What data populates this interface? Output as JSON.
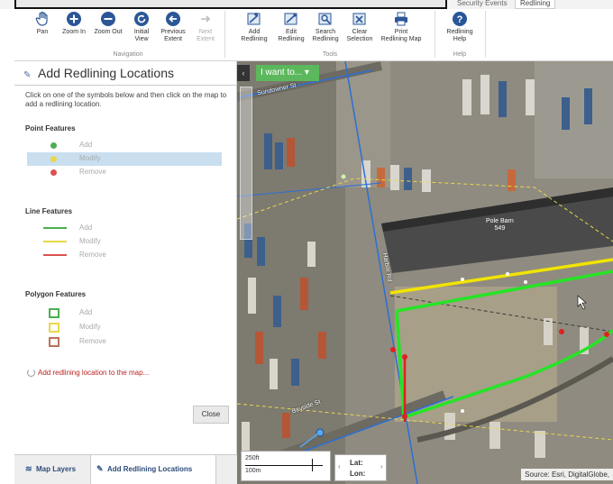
{
  "tabs": {
    "security": "Security Events",
    "redlining": "Redlining"
  },
  "ribbon": {
    "navigation": {
      "group_label": "Navigation",
      "pan": "Pan",
      "zoom_in": "Zoom In",
      "zoom_out": "Zoom Out",
      "initial_view_l1": "Initial",
      "initial_view_l2": "View",
      "previous_extent_l1": "Previous",
      "previous_extent_l2": "Extent",
      "next_extent_l1": "Next",
      "next_extent_l2": "Extent"
    },
    "tools": {
      "group_label": "Tools",
      "add_l1": "Add",
      "add_l2": "Redlining",
      "edit_l1": "Edit",
      "edit_l2": "Redlining",
      "search_l1": "Search",
      "search_l2": "Redlining",
      "clear_l1": "Clear",
      "clear_l2": "Selection",
      "print_l1": "Print",
      "print_l2": "Redlining Map"
    },
    "help": {
      "group_label": "Help",
      "help_l1": "Redlining",
      "help_l2": "Help"
    }
  },
  "panel": {
    "title": "Add Redlining Locations",
    "intro": "Click on one of the symbols below and then click on the map to add a redlining location.",
    "point": {
      "heading": "Point Features",
      "add": "Add",
      "modify": "Modify",
      "remove": "Remove"
    },
    "line": {
      "heading": "Line Features",
      "add": "Add",
      "modify": "Modify",
      "remove": "Remove"
    },
    "polygon": {
      "heading": "Polygon Features",
      "add": "Add",
      "modify": "Modify",
      "remove": "Remove"
    },
    "status": "Add redlining location to the map...",
    "close": "Close",
    "bottom_tabs": {
      "map_layers": "Map Layers",
      "add_redlining": "Add Redlining Locations"
    }
  },
  "colors": {
    "add": "#4caf50",
    "modify": "#e8d84a",
    "remove": "#d9534f",
    "accent": "#5cb85c"
  },
  "map": {
    "i_want_to": "I want to...",
    "street_1": "Sundowner St",
    "street_2": "Bayside St",
    "street_3": "Harbor Rd",
    "building_l1": "Pole Barn",
    "building_l2": "549",
    "scale_1": "250ft",
    "scale_2": "100m",
    "lat": "Lat:",
    "lon": "Lon:",
    "source": "Source: Esri, DigitalGlobe,"
  }
}
